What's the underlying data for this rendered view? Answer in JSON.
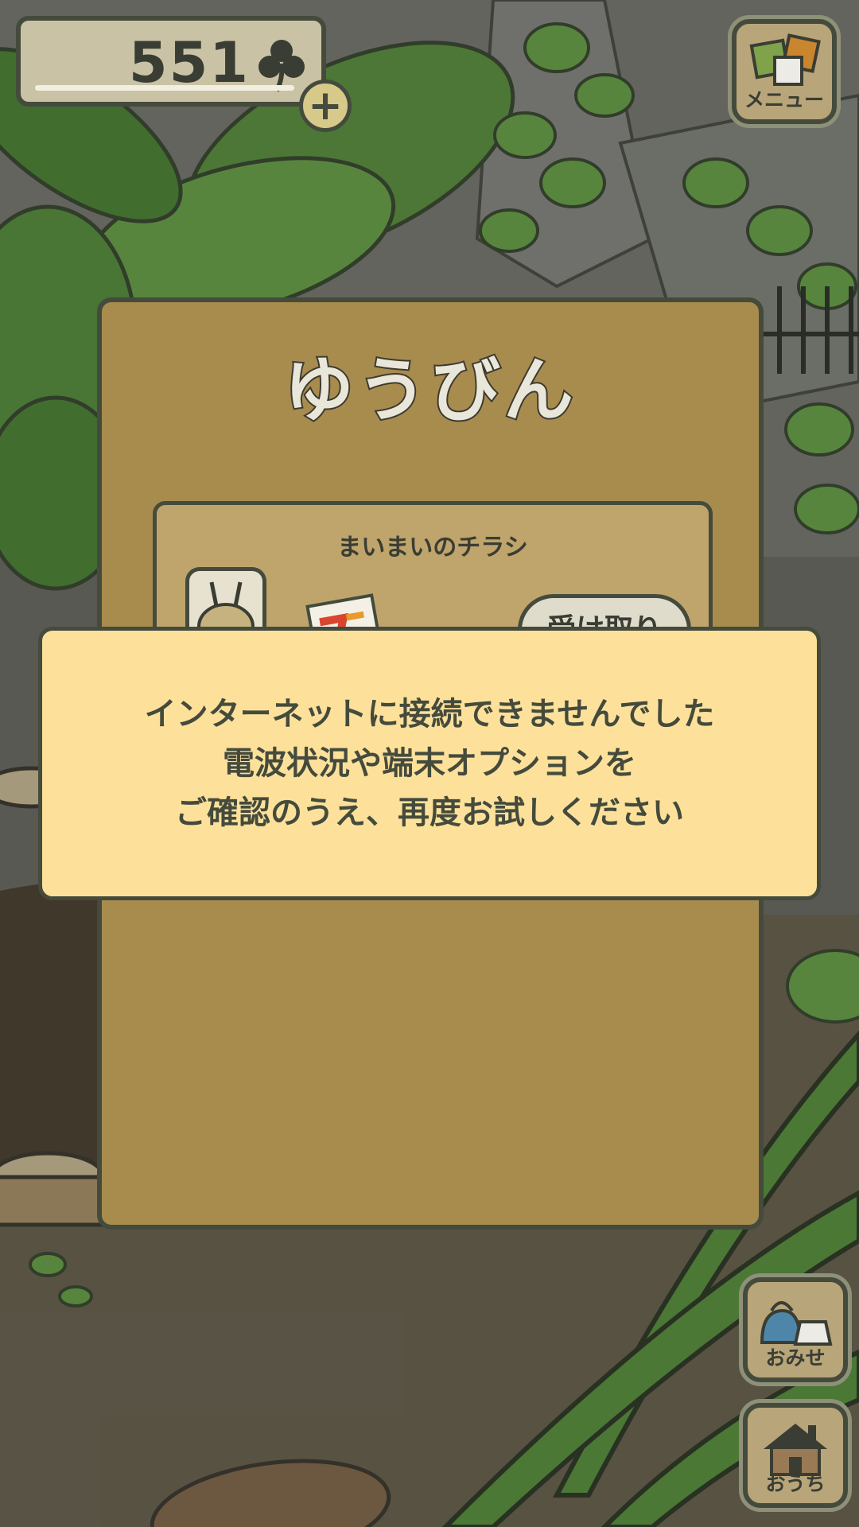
{
  "hud": {
    "clover_count": "551",
    "add_label": "+"
  },
  "side_buttons": {
    "menu_label": "メニュー",
    "shop_label": "おみせ",
    "home_label": "おうち"
  },
  "mail_panel": {
    "title": "ゆうびん",
    "items": [
      {
        "title": "まいまいのチラシ",
        "button_label": "受け取り"
      }
    ]
  },
  "error_dialog": {
    "lines": [
      "インターネットに接続できませんでした",
      "電波状況や端末オプションを",
      "ご確認のうえ、再度お試しください"
    ]
  },
  "colors": {
    "panel": "#a88c4e",
    "dialog": "#fde19b",
    "outline": "#454b3c",
    "foliage": "#6fae4a"
  }
}
